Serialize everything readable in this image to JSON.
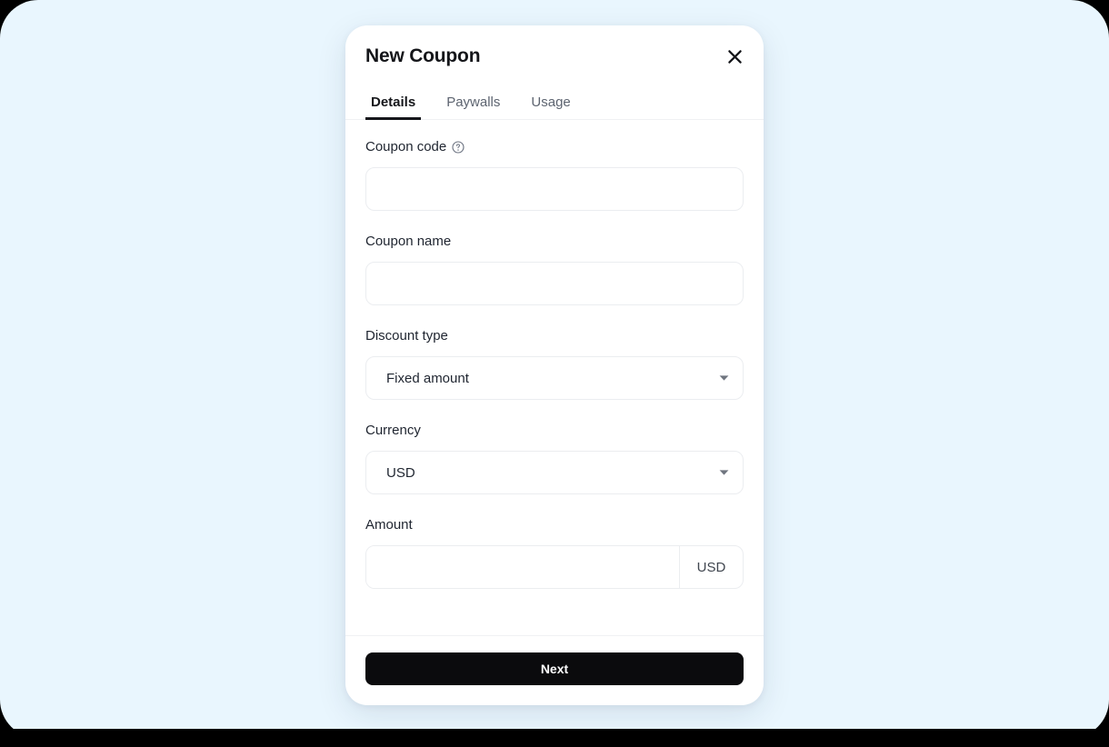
{
  "background": {
    "color": "#e9f6fe",
    "outer_color": "#000000"
  },
  "modal": {
    "title": "New Coupon",
    "close_icon": "close-icon",
    "accent_color": "#16171b",
    "tabs": [
      {
        "label": "Details",
        "active": true
      },
      {
        "label": "Paywalls",
        "active": false
      },
      {
        "label": "Usage",
        "active": false
      }
    ],
    "fields": {
      "coupon_code": {
        "label": "Coupon code",
        "help_icon": "help-circle-icon",
        "value": "",
        "placeholder": ""
      },
      "coupon_name": {
        "label": "Coupon name",
        "value": "",
        "placeholder": ""
      },
      "discount_type": {
        "label": "Discount type",
        "value": "Fixed amount",
        "caret_icon": "chevron-down-icon"
      },
      "currency": {
        "label": "Currency",
        "value": "USD",
        "caret_icon": "chevron-down-icon"
      },
      "amount": {
        "label": "Amount",
        "value": "",
        "placeholder": "",
        "suffix": "USD"
      }
    },
    "footer": {
      "next_label": "Next"
    }
  }
}
